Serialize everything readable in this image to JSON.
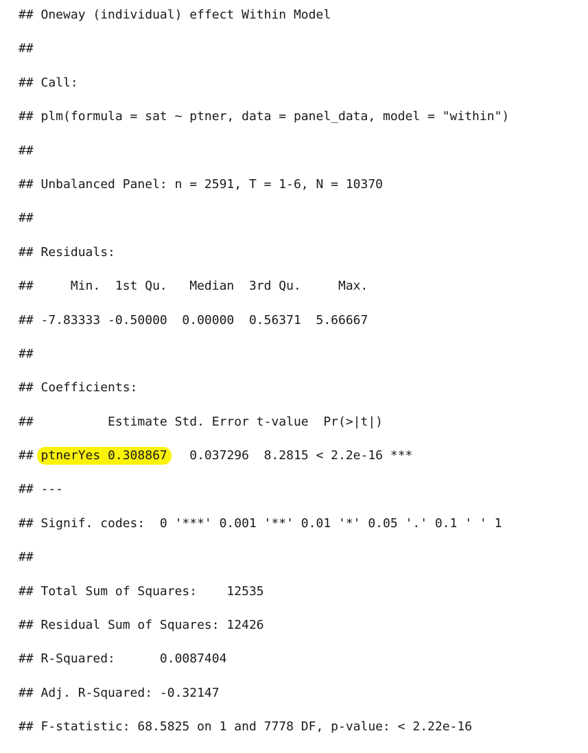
{
  "output": {
    "lines": [
      "## Oneway (individual) effect Within Model",
      "##",
      "## Call:",
      "## plm(formula = sat ~ ptner, data = panel_data, model = \"within\")",
      "##",
      "## Unbalanced Panel: n = 2591, T = 1-6, N = 10370",
      "##",
      "## Residuals:",
      "##     Min.  1st Qu.   Median  3rd Qu.     Max.",
      "## -7.83333 -0.50000  0.00000  0.56371  5.66667",
      "##",
      "## Coefficients:",
      "##          Estimate Std. Error t-value  Pr(>|t|)",
      "## ptnerYes 0.308867   0.037296  8.2815 < 2.2e-16 ***",
      "## ---",
      "## Signif. codes:  0 '***' 0.001 '**' 0.01 '*' 0.05 '.' 0.1 ' ' 1",
      "##",
      "## Total Sum of Squares:    12535",
      "## Residual Sum of Squares: 12426",
      "## R-Squared:      0.0087404",
      "## Adj. R-Squared: -0.32147",
      "## F-statistic: 68.5825 on 1 and 7778 DF, p-value: < 2.22e-16"
    ],
    "highlight": {
      "line_index": 13,
      "text": "ptnerYes 0.308867",
      "color": "#fbf20a"
    }
  }
}
